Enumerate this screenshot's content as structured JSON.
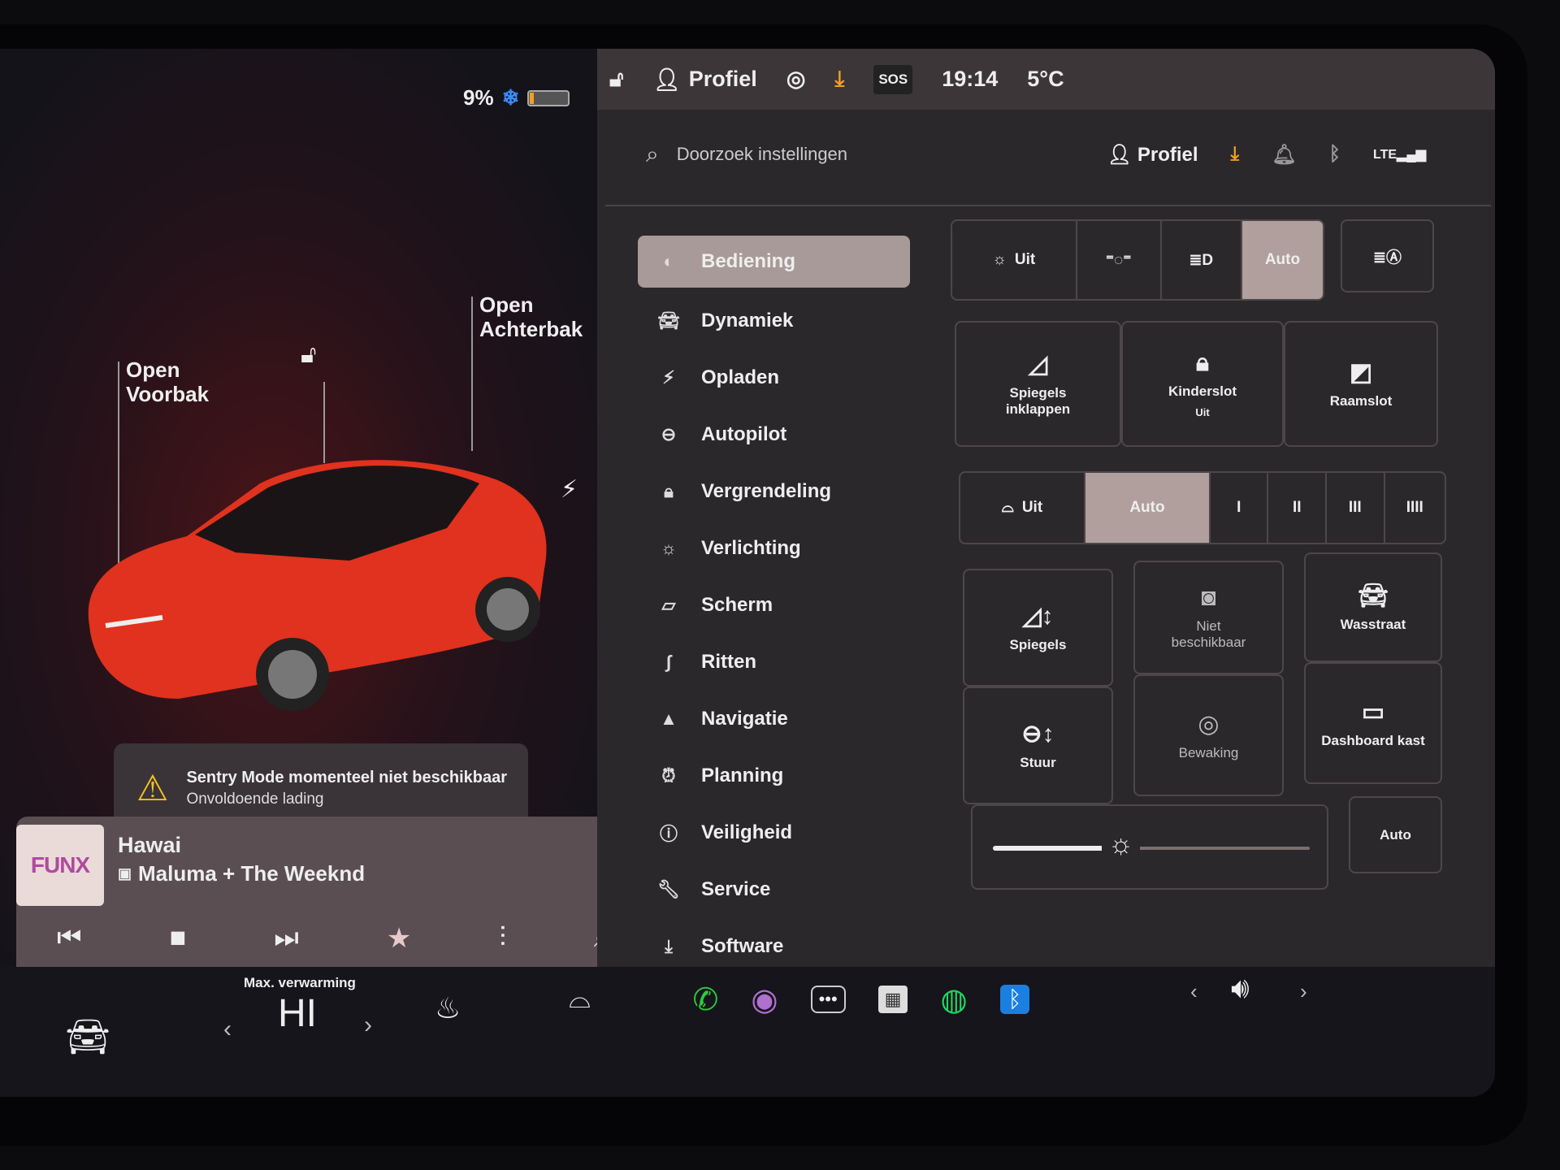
{
  "status_left": {
    "battery_percent": "9%",
    "battery_level": 9,
    "snowflake_icon": "snowflake-icon"
  },
  "car": {
    "front_trunk": "Open\nVoorbak",
    "front_trunk_l1": "Open",
    "front_trunk_l2": "Voorbak",
    "rear_trunk_l1": "Open",
    "rear_trunk_l2": "Achterbak",
    "color": "#e0321e"
  },
  "alert": {
    "title": "Sentry Mode momenteel niet beschikbaar",
    "subtitle": "Onvoldoende lading"
  },
  "media": {
    "station": "FUNX",
    "title": "Hawai",
    "artist": "Maluma + The Weeknd"
  },
  "topbar": {
    "profile": "Profiel",
    "sos": "SOS",
    "time": "19:14",
    "temperature": "5°C"
  },
  "settings": {
    "search_placeholder": "Doorzoek instellingen",
    "profile": "Profiel",
    "menu": [
      {
        "label": "Bediening",
        "icon": "toggle-icon"
      },
      {
        "label": "Dynamiek",
        "icon": "car-icon"
      },
      {
        "label": "Opladen",
        "icon": "bolt-icon"
      },
      {
        "label": "Autopilot",
        "icon": "steering-wheel-icon"
      },
      {
        "label": "Vergrendeling",
        "icon": "lock-icon"
      },
      {
        "label": "Verlichting",
        "icon": "sun-icon"
      },
      {
        "label": "Scherm",
        "icon": "display-icon"
      },
      {
        "label": "Ritten",
        "icon": "trips-icon"
      },
      {
        "label": "Navigatie",
        "icon": "navigation-icon"
      },
      {
        "label": "Planning",
        "icon": "alarm-icon"
      },
      {
        "label": "Veiligheid",
        "icon": "alert-circle-icon"
      },
      {
        "label": "Service",
        "icon": "wrench-icon"
      },
      {
        "label": "Software",
        "icon": "download-icon"
      }
    ],
    "lights": {
      "off": "Uit",
      "auto": "Auto",
      "selected": "Auto"
    },
    "tiles1": {
      "mirrors_fold": "Spiegels inklappen",
      "child_lock": "Kinderslot",
      "child_lock_state": "Uit",
      "window_lock": "Raamslot"
    },
    "wipers": {
      "off": "Uit",
      "auto": "Auto",
      "selected": "Auto",
      "speeds": [
        "I",
        "II",
        "III",
        "IIII"
      ]
    },
    "tiles2": {
      "mirrors": "Spiegels",
      "unavailable": "Niet beschikbaar",
      "wash": "Wasstraat",
      "wheel": "Stuur",
      "sentry": "Bewaking",
      "glovebox": "Dashboard kast"
    },
    "brightness": {
      "level": 40,
      "auto": "Auto"
    }
  },
  "bottom": {
    "climate_label": "Max. verwarming",
    "temp": "HI"
  },
  "colors": {
    "accent_orange": "#f0a020",
    "selected": "#b09f9c",
    "spotify": "#1ed760",
    "bluetooth": "#1a7fe0",
    "phone": "#2ecc40"
  }
}
